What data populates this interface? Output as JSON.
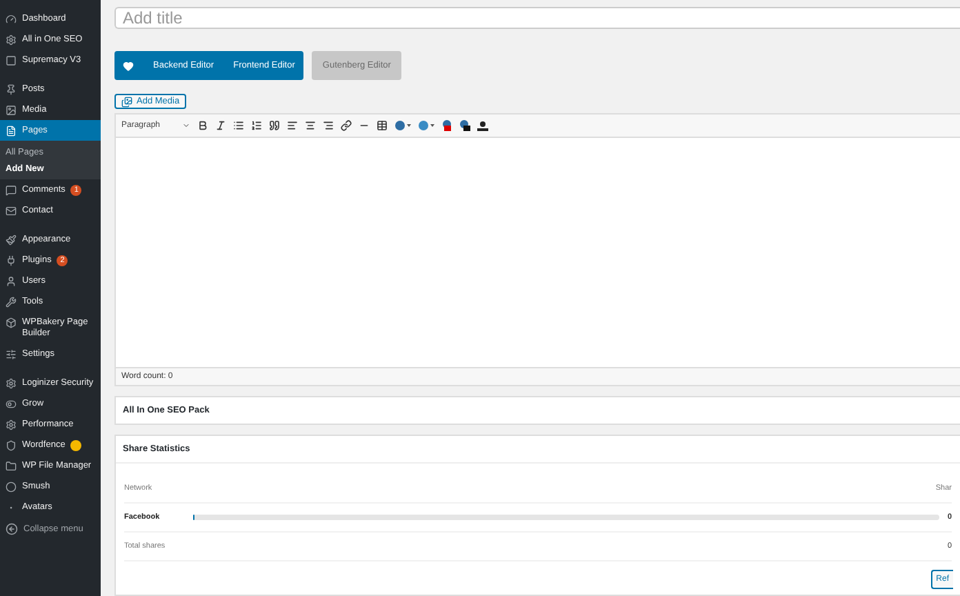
{
  "sidebar": {
    "items": [
      {
        "label": "Dashboard",
        "selected": false
      },
      {
        "label": "All in One SEO",
        "selected": false
      },
      {
        "label": "Supremacy V3",
        "selected": false
      },
      {
        "label": "Posts",
        "selected": false
      },
      {
        "label": "Media",
        "selected": false
      },
      {
        "label": "Pages",
        "selected": true,
        "children": [
          {
            "label": "All Pages",
            "selected": false
          },
          {
            "label": "Add New",
            "selected": true
          }
        ]
      },
      {
        "label": "Comments",
        "selected": false,
        "badge": "1"
      },
      {
        "label": "Contact",
        "selected": false
      },
      {
        "label": "Appearance",
        "selected": false
      },
      {
        "label": "Plugins",
        "selected": false,
        "badge": "2"
      },
      {
        "label": "Users",
        "selected": false
      },
      {
        "label": "Tools",
        "selected": false
      },
      {
        "label": "WPBakery Page Builder",
        "selected": false
      },
      {
        "label": "Settings",
        "selected": false
      },
      {
        "label": "Loginizer Security",
        "selected": false
      },
      {
        "label": "Grow",
        "selected": false
      },
      {
        "label": "Performance",
        "selected": false
      },
      {
        "label": "Wordfence",
        "selected": false,
        "notice": true
      },
      {
        "label": "WP File Manager",
        "selected": false
      },
      {
        "label": "Smush",
        "selected": false
      },
      {
        "label": "Avatars",
        "selected": false
      }
    ],
    "collapse": "Collapse menu"
  },
  "title_field": {
    "placeholder": "Add title"
  },
  "builder_buttons": [
    {
      "label": "Backend Editor",
      "disabled": false
    },
    {
      "label": "Frontend Editor",
      "disabled": false
    },
    {
      "label": "Gutenberg Editor",
      "disabled": true
    }
  ],
  "add_media": "Add Media",
  "toolbar": {
    "format": "Paragraph"
  },
  "word_count": "Word count: 0",
  "seo_box": {
    "title": "All In One SEO Pack"
  },
  "share_stats": {
    "title": "Share Statistics",
    "columns": [
      "Network",
      "Shar"
    ],
    "rows": [
      {
        "kind": "network",
        "network": "Facebook",
        "level": 0,
        "shares": "0"
      },
      {
        "kind": "total",
        "network": "Total shares",
        "shares": "0"
      }
    ],
    "button": "Ref"
  }
}
